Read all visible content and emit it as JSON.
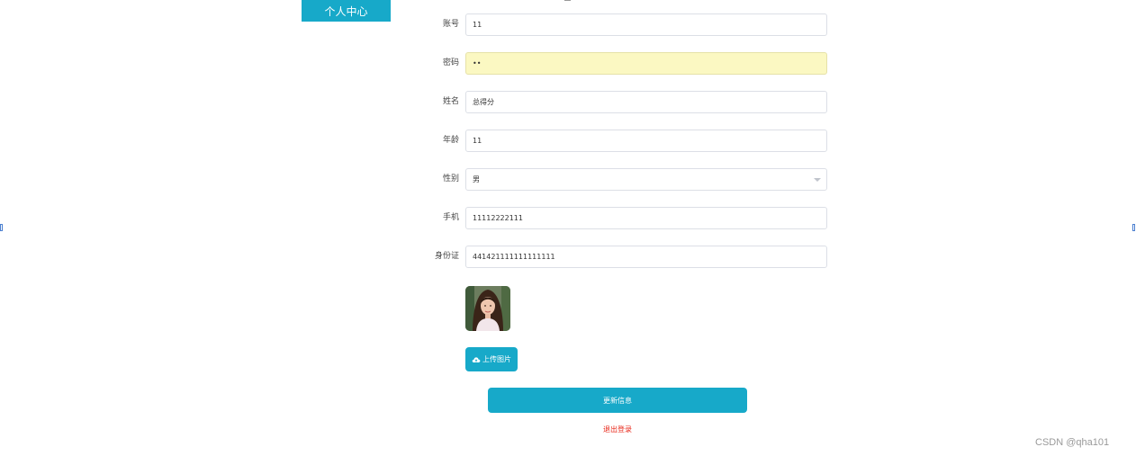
{
  "sidebar": {
    "active_tab_label": "个人中心"
  },
  "form": {
    "account_label": "账号",
    "account_value": "11",
    "password_label": "密码",
    "password_value": "••",
    "name_label": "姓名",
    "name_value": "总得分",
    "age_label": "年龄",
    "age_value": "11",
    "gender_label": "性别",
    "gender_value": "男",
    "phone_label": "手机",
    "phone_value": "11112222111",
    "idcard_label": "身份证",
    "idcard_value": "441421111111111111"
  },
  "actions": {
    "upload_label": "上传图片",
    "update_label": "更新信息",
    "logout_label": "退出登录"
  },
  "watermark": "CSDN @qha101",
  "colors": {
    "accent": "#17a9c9",
    "danger": "#e8291b",
    "autofill": "#fbf8c2"
  }
}
